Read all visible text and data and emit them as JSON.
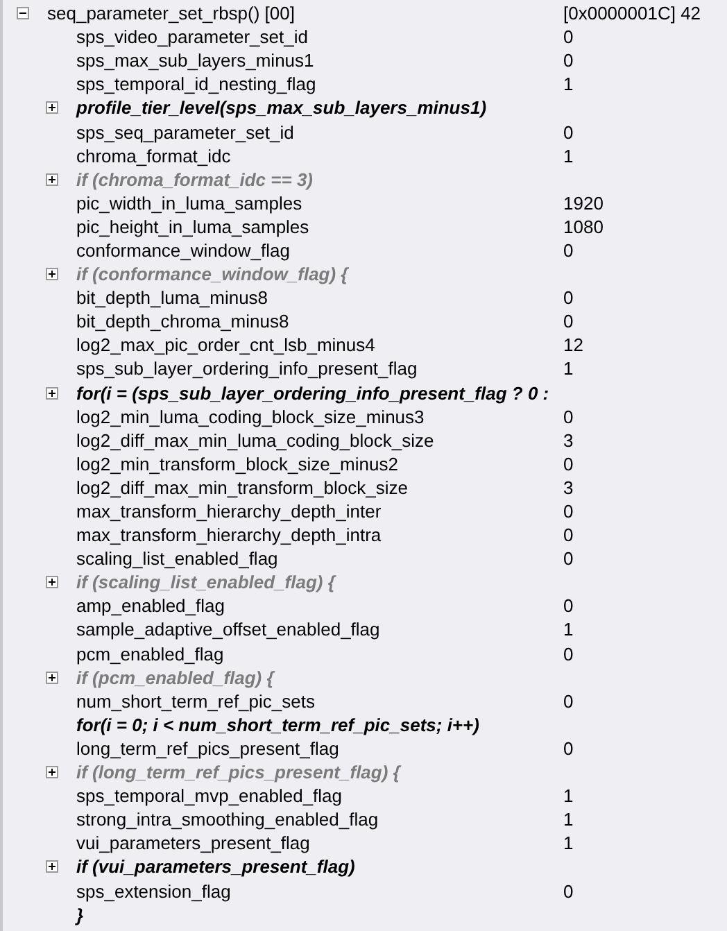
{
  "tree": {
    "label": "seq_parameter_set_rbsp() [00]",
    "value": "[0x0000001C] 42",
    "expanded": true,
    "children": [
      {
        "kind": "field",
        "label": "sps_video_parameter_set_id",
        "value": "0"
      },
      {
        "kind": "field",
        "label": "sps_max_sub_layers_minus1",
        "value": "0"
      },
      {
        "kind": "field",
        "label": "sps_temporal_id_nesting_flag",
        "value": "1"
      },
      {
        "kind": "call",
        "label": "profile_tier_level(sps_max_sub_layers_minus1)",
        "expanded": false
      },
      {
        "kind": "field",
        "label": "sps_seq_parameter_set_id",
        "value": "0"
      },
      {
        "kind": "field",
        "label": "chroma_format_idc",
        "value": "1"
      },
      {
        "kind": "condition",
        "label": "if (chroma_format_idc == 3)",
        "expanded": false
      },
      {
        "kind": "field",
        "label": "pic_width_in_luma_samples",
        "value": "1920"
      },
      {
        "kind": "field",
        "label": "pic_height_in_luma_samples",
        "value": "1080"
      },
      {
        "kind": "field",
        "label": "conformance_window_flag",
        "value": "0"
      },
      {
        "kind": "condition",
        "label": "if (conformance_window_flag) {",
        "expanded": false
      },
      {
        "kind": "field",
        "label": "bit_depth_luma_minus8",
        "value": "0"
      },
      {
        "kind": "field",
        "label": "bit_depth_chroma_minus8",
        "value": "0"
      },
      {
        "kind": "field",
        "label": "log2_max_pic_order_cnt_lsb_minus4",
        "value": "12"
      },
      {
        "kind": "field",
        "label": "sps_sub_layer_ordering_info_present_flag",
        "value": "1"
      },
      {
        "kind": "call",
        "label": "for(i = (sps_sub_layer_ordering_info_present_flag ? 0 :",
        "expanded": false
      },
      {
        "kind": "field",
        "label": "log2_min_luma_coding_block_size_minus3",
        "value": "0"
      },
      {
        "kind": "field",
        "label": "log2_diff_max_min_luma_coding_block_size",
        "value": "3"
      },
      {
        "kind": "field",
        "label": "log2_min_transform_block_size_minus2",
        "value": "0"
      },
      {
        "kind": "field",
        "label": "log2_diff_max_min_transform_block_size",
        "value": "3"
      },
      {
        "kind": "field",
        "label": "max_transform_hierarchy_depth_inter",
        "value": "0"
      },
      {
        "kind": "field",
        "label": "max_transform_hierarchy_depth_intra",
        "value": "0"
      },
      {
        "kind": "field",
        "label": "scaling_list_enabled_flag",
        "value": "0"
      },
      {
        "kind": "condition",
        "label": "if (scaling_list_enabled_flag) {",
        "expanded": false
      },
      {
        "kind": "field",
        "label": "amp_enabled_flag",
        "value": "0"
      },
      {
        "kind": "field",
        "label": "sample_adaptive_offset_enabled_flag",
        "value": "1"
      },
      {
        "kind": "field",
        "label": "pcm_enabled_flag",
        "value": "0"
      },
      {
        "kind": "condition",
        "label": "if (pcm_enabled_flag) {",
        "expanded": false
      },
      {
        "kind": "field",
        "label": "num_short_term_ref_pic_sets",
        "value": "0"
      },
      {
        "kind": "call",
        "label": "for(i = 0; i < num_short_term_ref_pic_sets; i++)"
      },
      {
        "kind": "field",
        "label": "long_term_ref_pics_present_flag",
        "value": "0"
      },
      {
        "kind": "condition",
        "label": "if (long_term_ref_pics_present_flag) {",
        "expanded": false
      },
      {
        "kind": "field",
        "label": "sps_temporal_mvp_enabled_flag",
        "value": "1"
      },
      {
        "kind": "field",
        "label": "strong_intra_smoothing_enabled_flag",
        "value": "1"
      },
      {
        "kind": "field",
        "label": "vui_parameters_present_flag",
        "value": "1"
      },
      {
        "kind": "call",
        "label": "if (vui_parameters_present_flag)",
        "expanded": false
      },
      {
        "kind": "field",
        "label": "sps_extension_flag",
        "value": "0"
      },
      {
        "kind": "call",
        "label": "}"
      }
    ]
  }
}
